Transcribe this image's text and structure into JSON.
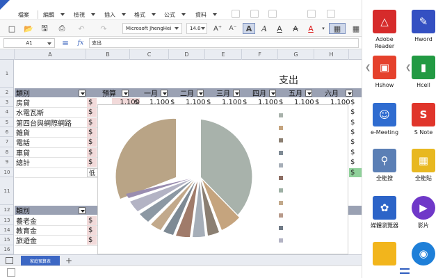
{
  "menu": {
    "items": [
      "檔案",
      "編輯",
      "檢視",
      "插入",
      "格式",
      "公式",
      "資料"
    ]
  },
  "toolbar": {
    "font_name": "Microsoft JhengHei",
    "font_size": "14.0"
  },
  "formula_bar": {
    "cell_ref": "A1",
    "eq": "=",
    "fx": "fx",
    "content": "支出"
  },
  "columns": [
    "A",
    "B",
    "C",
    "D",
    "E",
    "F",
    "G",
    "H"
  ],
  "rows": [
    "1",
    "2",
    "3",
    "4",
    "5",
    "6",
    "7",
    "8",
    "9",
    "10",
    "11",
    "12",
    "13",
    "14",
    "15",
    "16"
  ],
  "sheet": {
    "title": "支出",
    "header": [
      "類別",
      "預算",
      "一月",
      "二月",
      "三月",
      "四月",
      "五月",
      "六月"
    ],
    "expense_rows": [
      "房貸",
      "水電瓦斯",
      "第四台與網際網路",
      "雜貨",
      "電話",
      "車貸",
      "總計"
    ],
    "value_sample": "1,100",
    "cut_label": "低",
    "section2_header": "類別",
    "section2_rows": [
      "養老金",
      "教育金",
      "旅遊金"
    ],
    "currency": "$"
  },
  "sheet_tabs": {
    "active": "家庭預算表",
    "add": "+"
  },
  "colors": {
    "accent": "#3c67c4",
    "header_band": "#9aa1b3",
    "pie": [
      "#a8b2ab",
      "#c5a47e",
      "#b9a486",
      "#8b7f72",
      "#a07b6a",
      "#9a8db0",
      "#7e8a94",
      "#b89a8a",
      "#a6aeb8",
      "#c2a98b",
      "#8c98a3",
      "#b3b3c4"
    ]
  },
  "launcher": {
    "apps": [
      {
        "label": "Adobe Reader",
        "icon": "adobe-reader-icon",
        "color": "#d62b2b"
      },
      {
        "label": "Hword",
        "icon": "hword-icon",
        "color": "#3450c2"
      },
      {
        "label": "Hshow",
        "icon": "hshow-icon",
        "color": "#e5412c"
      },
      {
        "label": "Hcell",
        "icon": "hcell-icon",
        "color": "#229a43"
      },
      {
        "label": "e-Meeting",
        "icon": "e-meeting-icon",
        "color": "#2f6cd0"
      },
      {
        "label": "S Note",
        "icon": "s-note-icon",
        "color": "#e0352b"
      },
      {
        "label": "全能搜",
        "icon": "search-app-icon",
        "color": "#5b7fb5"
      },
      {
        "label": "全能貼",
        "icon": "paste-app-icon",
        "color": "#e8b820"
      },
      {
        "label": "媒體瀏覽器",
        "icon": "media-browser-icon",
        "color": "#2c64c8"
      },
      {
        "label": "影片",
        "icon": "video-icon",
        "color": "#6f38c8"
      },
      {
        "label": "",
        "icon": "folder-icon",
        "color": "#f2b51c"
      },
      {
        "label": "",
        "icon": "globe-icon",
        "color": "#1e7fd8"
      }
    ]
  }
}
